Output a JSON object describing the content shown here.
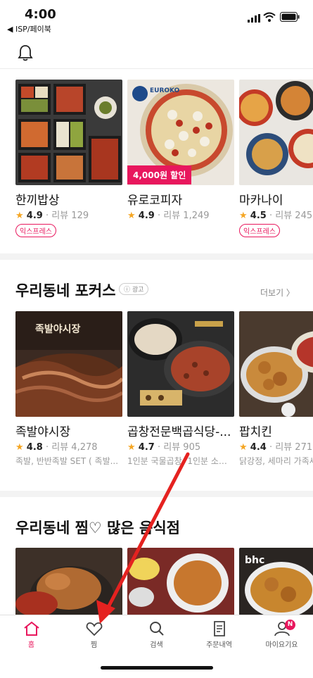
{
  "status_bar": {
    "time": "4:00",
    "back_app": "◀ ISP/페이북"
  },
  "section_top": {
    "cards": [
      {
        "name": "한끼밥상",
        "rating": "4.9",
        "review_label": "리뷰",
        "reviews": "129",
        "tag": "익스프레스"
      },
      {
        "name": "유로코피자",
        "rating": "4.9",
        "review_label": "리뷰",
        "reviews": "1,249",
        "discount": "4,000원 할인"
      },
      {
        "name": "마카나이",
        "rating": "4.5",
        "review_label": "리뷰",
        "reviews": "245",
        "tag": "익스프레스"
      }
    ]
  },
  "section_focus": {
    "title": "우리동네 포커스",
    "ad_label": "ⓘ 광고",
    "more_label": "더보기 〉",
    "cards": [
      {
        "name": "족발야시장",
        "rating": "4.8",
        "review_label": "리뷰",
        "reviews": "4,278",
        "menu": "족발, 반반족발 SET ( 족발..."
      },
      {
        "name": "곱창전문백곱식당-...",
        "rating": "4.7",
        "review_label": "리뷰",
        "reviews": "905",
        "menu": "1인분 국물곱창, 1인분 소곱..."
      },
      {
        "name": "팝치킨",
        "rating": "4.4",
        "review_label": "리뷰",
        "reviews": "271",
        "menu": "닭강정, 세마리 가족세트"
      }
    ]
  },
  "section_fav": {
    "title": "우리동네 찜♡ 많은 음식점"
  },
  "nav": {
    "items": [
      {
        "label": "홈",
        "icon": "home-icon"
      },
      {
        "label": "찜",
        "icon": "heart-icon"
      },
      {
        "label": "검색",
        "icon": "search-icon"
      },
      {
        "label": "주문내역",
        "icon": "receipt-icon"
      },
      {
        "label": "마이요기요",
        "icon": "user-icon"
      }
    ],
    "badge": "N"
  },
  "colors": {
    "accent": "#e8175d",
    "star": "#f5a623",
    "arrow": "#e52220"
  }
}
